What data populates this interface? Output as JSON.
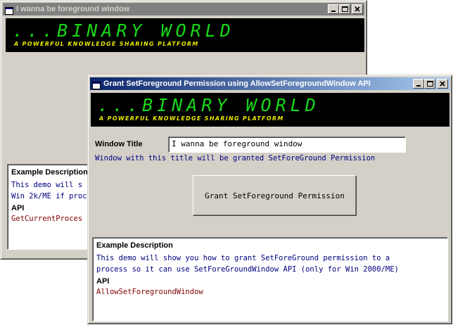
{
  "back_window": {
    "title": "I wanna be foreground window",
    "banner": {
      "title": "...BINARY WORLD",
      "subtitle": "A POWERFUL KNOWLEDGE SHARING PLATFORM"
    },
    "description": {
      "heading": "Example Description",
      "line1": "This demo will s",
      "line2": "Win 2k/ME if proc",
      "api_heading": "API",
      "api_value": "GetCurrentProces"
    }
  },
  "front_window": {
    "title": "Grant SetForeground Permission using AllowSetForegroundWindow API",
    "banner": {
      "title": "...BINARY WORLD",
      "subtitle": "A POWERFUL KNOWLEDGE SHARING PLATFORM"
    },
    "window_title_label": "Window Title",
    "window_title_value": "I wanna be foreground window",
    "hint": "Window with this title will be granted SetForeGround Permission",
    "grant_button": "Grant SetForeground Permission",
    "description": {
      "heading": "Example Description",
      "line1": "This demo will show you how to grant SetForeGround permission to a",
      "line2": "process so it can use SetForeGroundWindow API (only for Win 2000/ME)",
      "api_heading": "API",
      "api_value": "AllowSetForegroundWindow"
    }
  },
  "icons": {
    "app": "vb-form-icon",
    "minimize": "minimize-icon",
    "maximize": "maximize-icon",
    "close": "close-icon"
  },
  "colors": {
    "face": "#d4d0c8",
    "active_title_start": "#0a246a",
    "active_title_end": "#a6caf0",
    "inactive_title": "#808080",
    "banner_bg": "#000000",
    "banner_title": "#18d818",
    "banner_subtitle": "#e8e800",
    "desc_text": "#000080",
    "api_text": "#800000"
  }
}
